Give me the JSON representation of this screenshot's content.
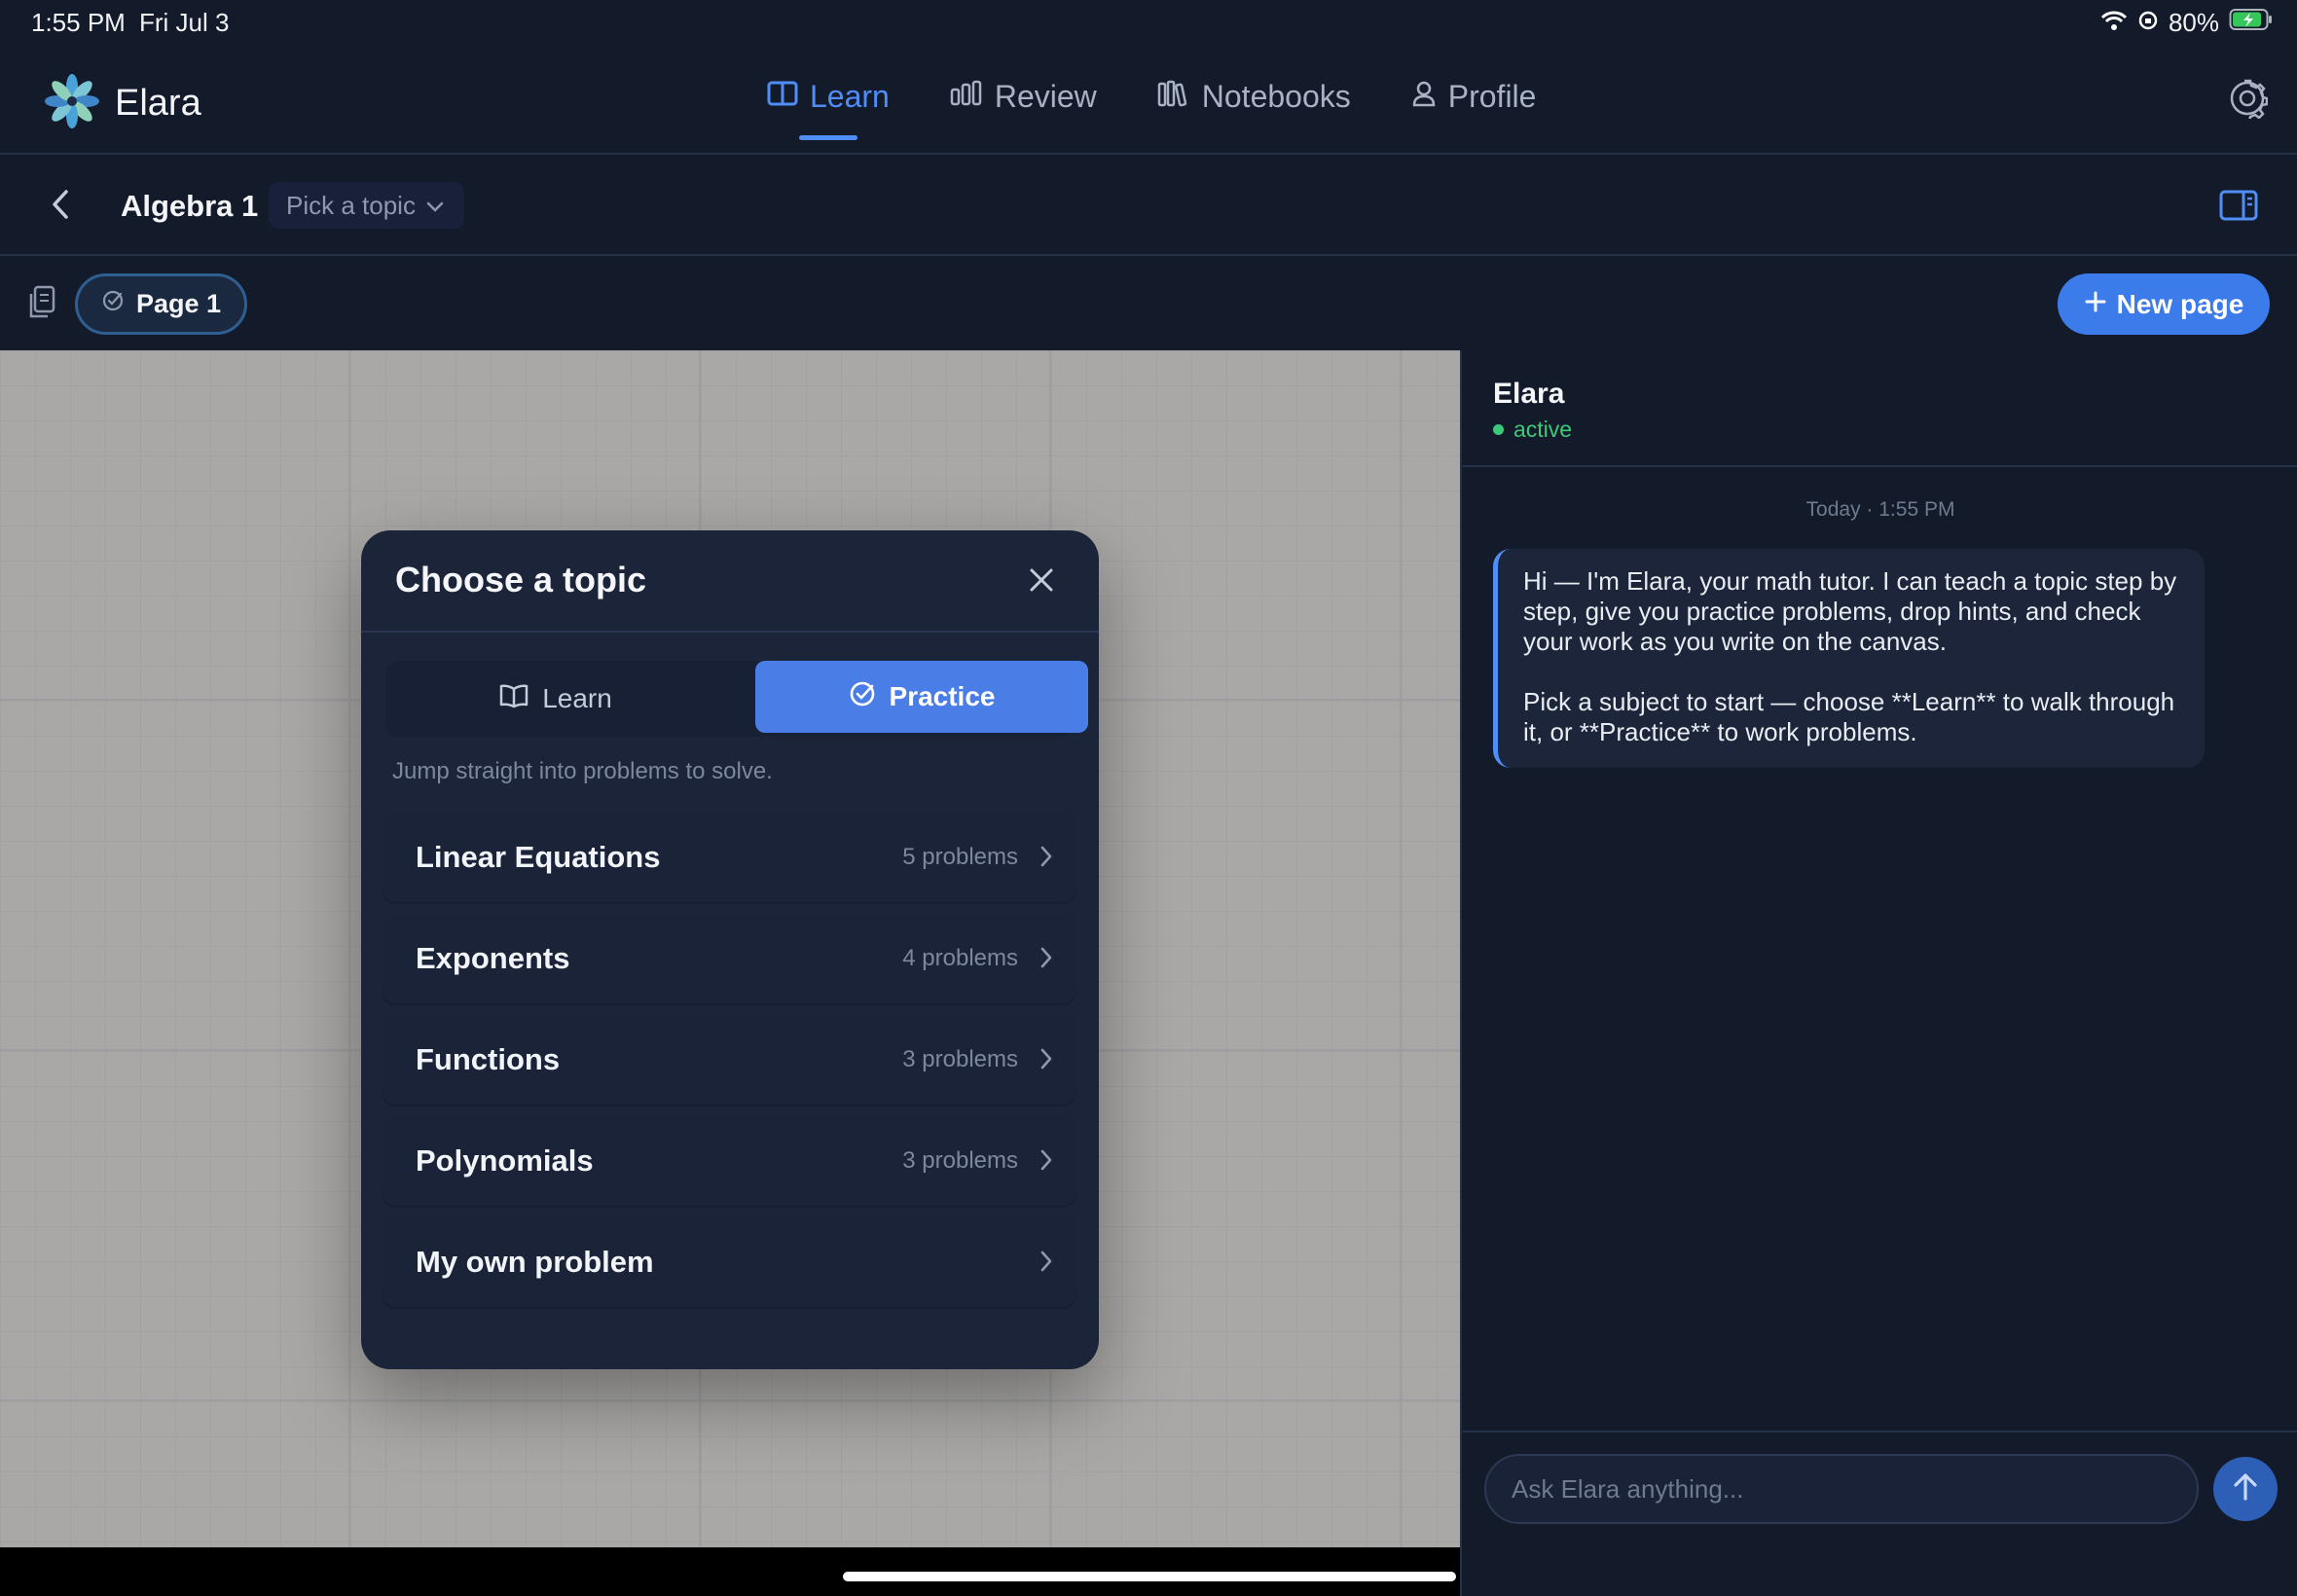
{
  "status_bar": {
    "time": "1:55 PM",
    "date": "Fri Jul 3",
    "battery": "80%"
  },
  "app": {
    "name": "Elara"
  },
  "nav": {
    "tabs": [
      {
        "label": "Learn",
        "icon": "book-icon",
        "active": true
      },
      {
        "label": "Review",
        "icon": "bar-chart-icon",
        "active": false
      },
      {
        "label": "Notebooks",
        "icon": "library-icon",
        "active": false
      },
      {
        "label": "Profile",
        "icon": "user-icon",
        "active": false
      }
    ]
  },
  "subheader": {
    "title": "Algebra 1",
    "topic_picker": "Pick a topic"
  },
  "pagebar": {
    "page_label": "Page 1",
    "new_page_label": "New page"
  },
  "modal": {
    "title": "Choose a topic",
    "segments": {
      "learn": "Learn",
      "practice": "Practice",
      "active": "practice"
    },
    "hint": "Jump straight into problems to solve.",
    "topics": [
      {
        "name": "Linear Equations",
        "count": "5 problems"
      },
      {
        "name": "Exponents",
        "count": "4 problems"
      },
      {
        "name": "Functions",
        "count": "3 problems"
      },
      {
        "name": "Polynomials",
        "count": "3 problems"
      },
      {
        "name": "My own problem",
        "count": ""
      }
    ]
  },
  "chat": {
    "name": "Elara",
    "status": "active",
    "timestamp": "Today · 1:55 PM",
    "message_p1": "Hi — I'm Elara, your math tutor. I can teach a topic step by step, give you practice problems, drop hints, and check your work as you write on the canvas.",
    "message_p2": "Pick a subject to start — choose **Learn** to walk through it, or **Practice** to work problems.",
    "input_placeholder": "Ask Elara anything..."
  },
  "colors": {
    "accent": "#4f8ef7",
    "button": "#3b7bea",
    "active_green": "#3cc978",
    "background": "#131a2a"
  }
}
